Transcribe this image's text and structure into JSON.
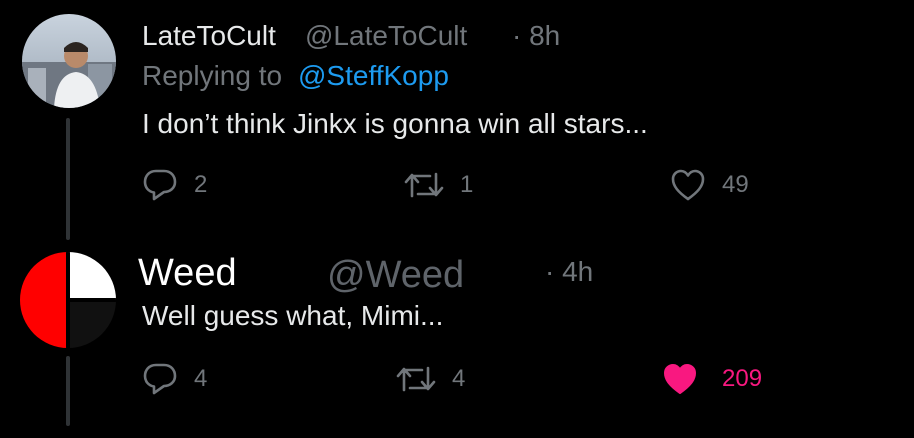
{
  "tweets": [
    {
      "display_name": "LateToCult",
      "handle": "@LateToCult",
      "time": "· 8h",
      "replying_prefix": "Replying to",
      "replying_to": "@SteffKopp",
      "text": "I don’t think Jinkx is gonna win all stars...",
      "reply_count": "2",
      "retweet_count": "1",
      "like_count": "49",
      "liked": false
    },
    {
      "display_name": "Weed",
      "handle": "@Weed",
      "time": "· 4h",
      "text": "Well guess what, Mimi...",
      "reply_count": "4",
      "retweet_count": "4",
      "like_count": "209",
      "liked": true
    }
  ],
  "colors": {
    "muted": "#71767b",
    "link": "#1d9bf0",
    "like": "#f91880",
    "thread_line": "#2f3336"
  },
  "icons": [
    "reply-icon",
    "retweet-icon",
    "heart-icon"
  ]
}
